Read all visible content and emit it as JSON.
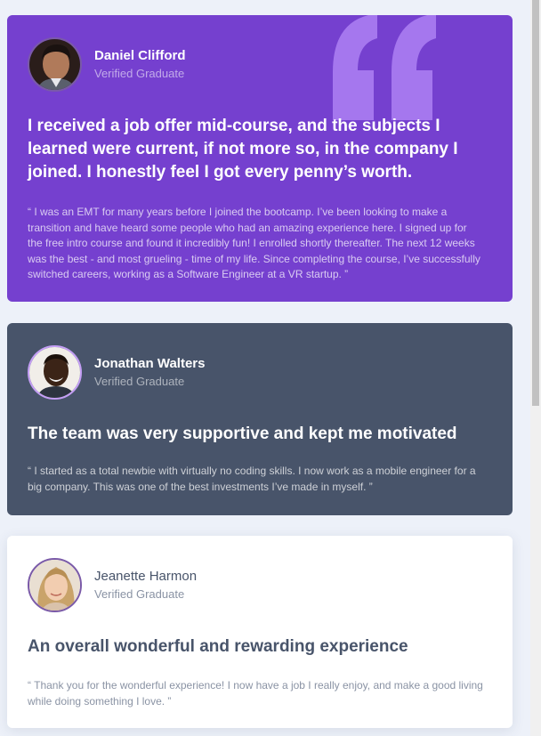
{
  "colors": {
    "purple_card": "#7540cf",
    "slate_card": "#48546a",
    "white_card": "#ffffff",
    "page_bg": "#edf1f9"
  },
  "testimonials": [
    {
      "name": "Daniel Clifford",
      "role": "Verified Graduate",
      "headline": "I received a job offer mid-course, and the subjects I learned were current, if not more so, in the company I joined. I honestly feel I got every penny’s worth.",
      "body": "“ I was an EMT for many years before I joined the bootcamp. I’ve been looking to make a transition and have heard some people who had an amazing experience here. I signed up for the free intro course and found it incredibly fun! I enrolled shortly thereafter. The next 12 weeks was the best - and most grueling - time of my life. Since completing the course, I’ve successfully switched careers, working as a Software Engineer at a VR startup. ”",
      "avatar": "avatar-daniel",
      "decoration": "quotation-icon"
    },
    {
      "name": "Jonathan Walters",
      "role": "Verified Graduate",
      "headline": "The team was very supportive and kept me motivated",
      "body": "“ I started as a total newbie with virtually no coding skills. I now work as a mobile engineer for a big company. This was one of the best investments I’ve made in myself. ”",
      "avatar": "avatar-jonathan"
    },
    {
      "name": "Jeanette Harmon",
      "role": "Verified Graduate",
      "headline": "An overall wonderful and rewarding experience",
      "body": "“ Thank you for the wonderful experience! I now have a job I really enjoy, and make a good living while doing something I love. ”",
      "avatar": "avatar-jeanette"
    }
  ]
}
